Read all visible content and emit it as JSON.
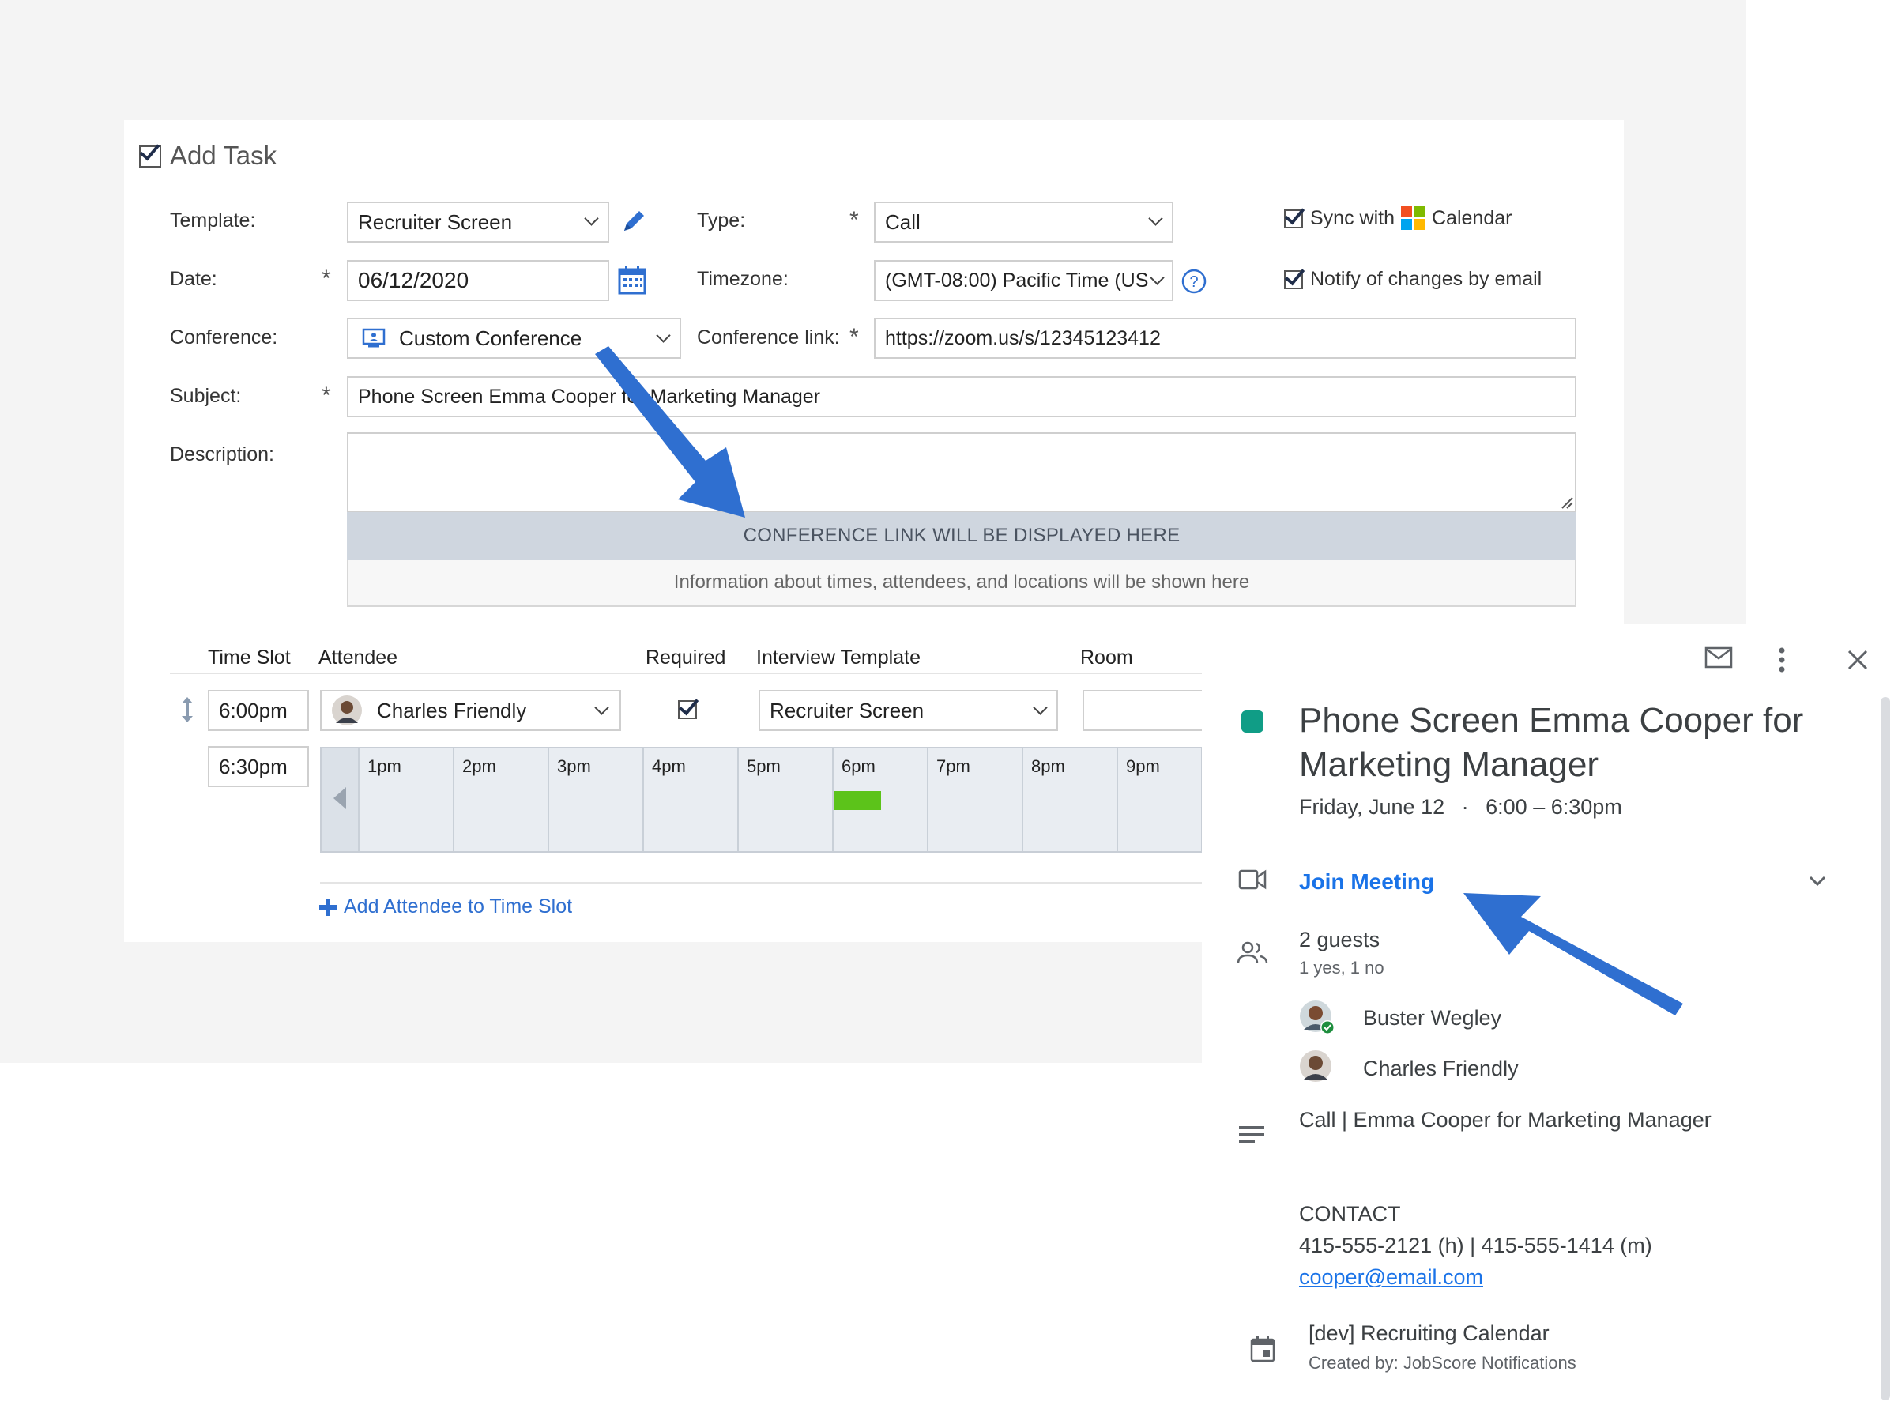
{
  "task": {
    "title": "Add Task",
    "template": {
      "label": "Template:",
      "value": "Recruiter Screen"
    },
    "type": {
      "label": "Type:",
      "value": "Call"
    },
    "date": {
      "label": "Date:",
      "value": "06/12/2020"
    },
    "timezone": {
      "label": "Timezone:",
      "value": "(GMT-08:00) Pacific Time (US"
    },
    "conference": {
      "label": "Conference:",
      "value": "Custom Conference"
    },
    "conference_link": {
      "label": "Conference link:",
      "value": "https://zoom.us/s/12345123412"
    },
    "subject": {
      "label": "Subject:",
      "value": "Phone Screen Emma Cooper for Marketing Manager"
    },
    "description": {
      "label": "Description:",
      "value": ""
    },
    "sync_prefix": "Sync with",
    "sync_suffix": "Calendar",
    "notify": "Notify of changes by email",
    "required_mark": "*",
    "conference_banner": "CONFERENCE LINK WILL BE DISPLAYED HERE",
    "info_banner": "Information about times, attendees, and locations will be shown here"
  },
  "slots": {
    "headers": {
      "time_slot": "Time Slot",
      "attendee": "Attendee",
      "required": "Required",
      "interview_template": "Interview Template",
      "room": "Room"
    },
    "start_time": "6:00pm",
    "end_time": "6:30pm",
    "attendee": "Charles Friendly",
    "interview_template": "Recruiter Screen",
    "room": "",
    "hours": [
      "1pm",
      "2pm",
      "3pm",
      "4pm",
      "5pm",
      "6pm",
      "7pm",
      "8pm",
      "9pm"
    ],
    "add_attendee": "Add Attendee to Time Slot",
    "slot_color": "#5cc31a"
  },
  "event": {
    "color": "#109d86",
    "title_line1": "Phone Screen Emma Cooper for",
    "title_line2": "Marketing Manager",
    "date": "Friday, June 12",
    "separator": "·",
    "time": "6:00 – 6:30pm",
    "join": "Join Meeting",
    "guests_count": "2 guests",
    "guests_status": "1 yes, 1 no",
    "guests": [
      "Buster Wegley",
      "Charles Friendly"
    ],
    "description_line": "Call | Emma Cooper for Marketing Manager",
    "contact_heading": "CONTACT",
    "contact_phones": "415-555-2121 (h) | 415-555-1414 (m)",
    "contact_email": "cooper@email.com",
    "calendar_name": "[dev] Recruiting Calendar",
    "created_by": "Created by: JobScore Notifications"
  },
  "colors": {
    "accent": "#1a73e8",
    "arrow": "#2f6fd0",
    "banner": "#cfd6df"
  }
}
